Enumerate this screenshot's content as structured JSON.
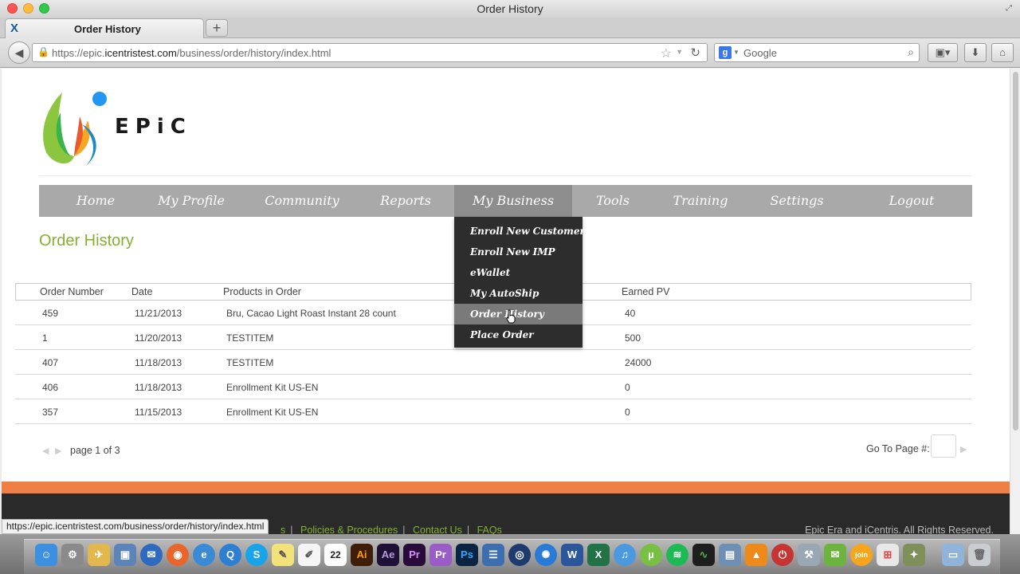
{
  "window": {
    "title": "Order History"
  },
  "tab": {
    "title": "Order History",
    "new_tab": "+"
  },
  "nav": {
    "url_prefix": "https://epic.",
    "url_domain": "icentristest.com",
    "url_path": "/business/order/history/index.html",
    "search_placeholder": "Google"
  },
  "logo": {
    "text": "EPiC"
  },
  "menu": {
    "items": [
      "Home",
      "My Profile",
      "Community",
      "Reports",
      "My Business",
      "Tools",
      "Training",
      "Settings",
      "Logout"
    ],
    "active": "My Business"
  },
  "dropdown": {
    "items": [
      "Enroll New Customer",
      "Enroll New IMP",
      "eWallet",
      "My AutoShip",
      "Order History",
      "Place Order"
    ],
    "hovered": "Order History"
  },
  "page": {
    "title": "Order History"
  },
  "table": {
    "headers": [
      "Order Number",
      "Date",
      "Products in Order",
      "Earned PV"
    ],
    "rows": [
      [
        "459",
        "11/21/2013",
        "Bru, Cacao Light Roast Instant 28 count",
        "40"
      ],
      [
        "1",
        "11/20/2013",
        "TESTITEM",
        "500"
      ],
      [
        "407",
        "11/18/2013",
        "TESTITEM",
        "24000"
      ],
      [
        "406",
        "11/18/2013",
        "Enrollment Kit US-EN",
        "0"
      ],
      [
        "357",
        "11/15/2013",
        "Enrollment Kit US-EN",
        "0"
      ]
    ]
  },
  "pager": {
    "text": "page 1 of 3",
    "goto_label": "Go To Page #:"
  },
  "footer": {
    "links": [
      "Policies & Procedures",
      "Contact Us",
      "FAQs"
    ],
    "link_partial": "s",
    "copyright": "Epic Era and iCentris. All Rights Reserved."
  },
  "status_url": "https://epic.icentristest.com/business/order/history/index.html",
  "dock": {
    "apps": [
      "finder",
      "system-prefs",
      "mail-bird",
      "photo",
      "thunderbird",
      "firefox",
      "ie",
      "quicktime",
      "skype",
      "stickies",
      "textedit",
      "calendar",
      "illustrator",
      "after-effects",
      "premiere",
      "prelude",
      "photoshop",
      "ebook",
      "cinema",
      "globe",
      "word",
      "excel",
      "itunes",
      "utorrent",
      "spotify",
      "activity-monitor",
      "preview",
      "vlc",
      "quit",
      "tool",
      "chat",
      "join-me",
      "windows",
      "dashcode",
      "folder",
      "trash"
    ],
    "calendar_day": "22",
    "labels": {
      "illustrator": "Ai",
      "after-effects": "Ae",
      "premiere": "Pr",
      "prelude": "Pr",
      "photoshop": "Ps",
      "word": "W",
      "excel": "X",
      "skype": "S"
    }
  },
  "colors": {
    "accent_green": "#86b033",
    "footer_orange": "#ef7f45",
    "menu_gray": "#a9a9a9",
    "dropdown_bg": "#2d2d2d"
  }
}
